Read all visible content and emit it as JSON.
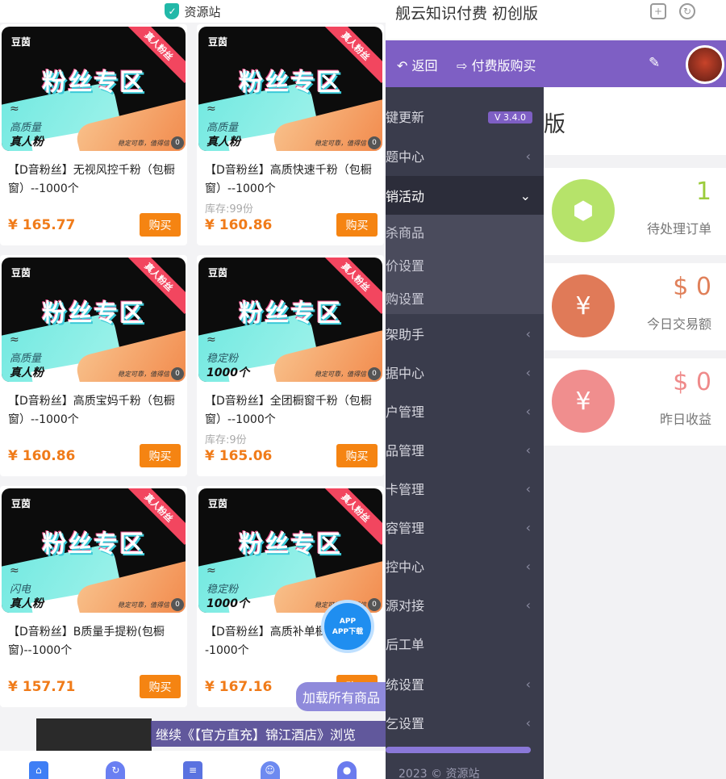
{
  "left": {
    "site_title": "资源站",
    "products": [
      {
        "title": "【D音粉丝】无视风控千粉（包橱窗）--1000个",
        "stock": "",
        "price": "¥ 165.77",
        "thumb_quality": "高质量",
        "thumb_tag": "真人粉"
      },
      {
        "title": "【D音粉丝】高质快速千粉（包橱窗）--1000个",
        "stock": "库存:99份",
        "price": "¥ 160.86",
        "thumb_quality": "高质量",
        "thumb_tag": "真人粉"
      },
      {
        "title": "【D音粉丝】高质宝妈千粉（包橱窗）--1000个",
        "stock": "",
        "price": "¥ 160.86",
        "thumb_quality": "高质量",
        "thumb_tag": "真人粉"
      },
      {
        "title": "【D音粉丝】全团橱窗千粉（包橱窗）--1000个",
        "stock": "库存:9份",
        "price": "¥ 165.06",
        "thumb_quality": "稳定粉",
        "thumb_tag": "1000个"
      },
      {
        "title": "【D音粉丝】B质量手提粉(包橱窗)--1000个",
        "stock": "",
        "price": "¥ 157.71",
        "thumb_quality": "闪电",
        "thumb_tag": "真人粉"
      },
      {
        "title": "【D音粉丝】高质补单橱窗）--1000个",
        "stock": "",
        "price": "¥ 167.16",
        "thumb_quality": "稳定粉",
        "thumb_tag": "1000个"
      }
    ],
    "thumb": {
      "brand": "豆茵",
      "ribbon": "真人粉丝",
      "headline": "粉丝专区",
      "tiny": "稳定可靠，值得信",
      "zero": "0"
    },
    "buy_label": "购买",
    "app_download": "APP下载",
    "app_label": "APP",
    "load_all": "加载所有商品",
    "marquee": "继续《【官方直充】锦江酒店》浏览"
  },
  "right": {
    "app_title": "舰云知识付费 初创版",
    "back_label": "返回",
    "paid_label": "付费版购买",
    "version": "V 3.4.0",
    "main_title": "版",
    "sidebar": [
      {
        "label": "键更新"
      },
      {
        "label": "题中心"
      },
      {
        "label": "销活动"
      },
      {
        "label": "杀商品"
      },
      {
        "label": "价设置"
      },
      {
        "label": "购设置"
      },
      {
        "label": "架助手"
      },
      {
        "label": "据中心"
      },
      {
        "label": "户管理"
      },
      {
        "label": "品管理"
      },
      {
        "label": "卡管理"
      },
      {
        "label": "容管理"
      },
      {
        "label": "控中心"
      },
      {
        "label": "源对接"
      },
      {
        "label": "后工单"
      },
      {
        "label": "统设置"
      },
      {
        "label": "乞设置"
      }
    ],
    "stats": [
      {
        "value": "1",
        "label": "待处理订单",
        "color": "#9ccc3c"
      },
      {
        "value": "$ 0",
        "label": "今日交易额",
        "color": "#e0805a"
      },
      {
        "value": "$ 0",
        "label": "昨日收益",
        "color": "#ef8a8a"
      }
    ],
    "copyright": "2023 © 资源站"
  }
}
